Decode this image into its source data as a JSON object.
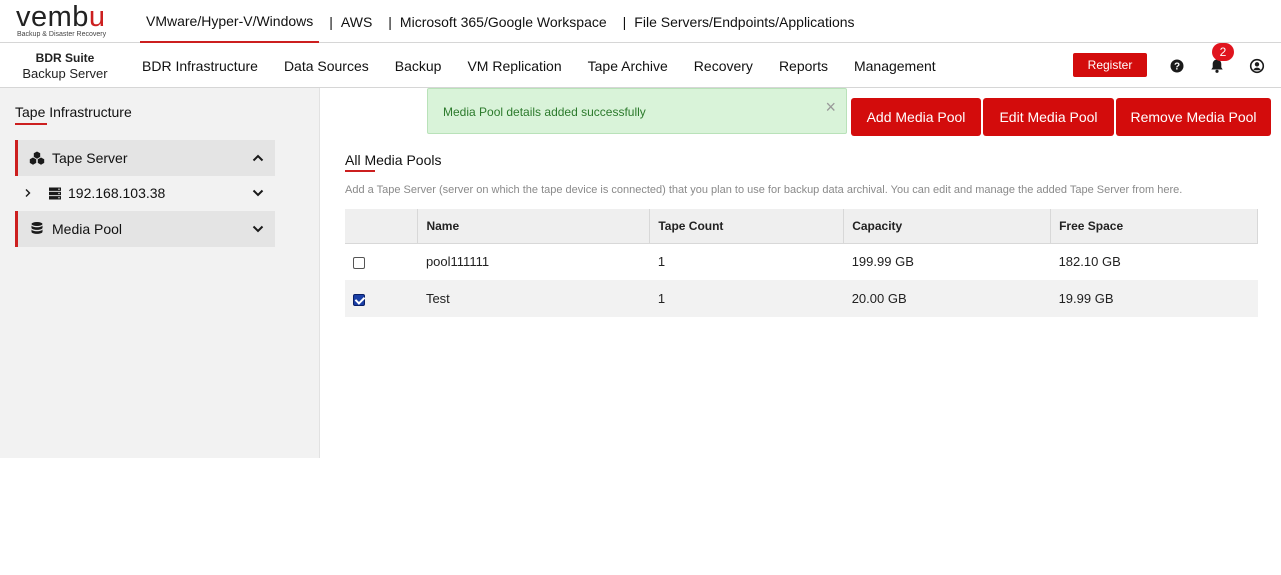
{
  "logo": {
    "word_start": "vemb",
    "word_end": "u",
    "tagline": "Backup & Disaster Recovery"
  },
  "product_tabs": [
    {
      "label": "VMware/Hyper-V/Windows",
      "active": true
    },
    {
      "label": "AWS",
      "active": false
    },
    {
      "label": "Microsoft 365/Google Workspace",
      "active": false
    },
    {
      "label": "File Servers/Endpoints/Applications",
      "active": false
    }
  ],
  "separator": "|",
  "brand": {
    "top": "BDR Suite",
    "bottom": "Backup Server"
  },
  "nav": [
    "BDR Infrastructure",
    "Data Sources",
    "Backup",
    "VM Replication",
    "Tape Archive",
    "Recovery",
    "Reports",
    "Management"
  ],
  "header": {
    "register_label": "Register",
    "notification_count": "2",
    "help_icon": "question-circle-icon",
    "bell_icon": "bell-icon",
    "user_icon": "user-circle-icon"
  },
  "sidebar": {
    "title": "Tape Infrastructure",
    "tape_server": {
      "label": "Tape Server",
      "icon": "server-cluster-icon",
      "expanded": true
    },
    "server_ip": "192.168.103.38",
    "media_pool": {
      "label": "Media Pool",
      "icon": "database-icon",
      "expanded": false
    }
  },
  "toast": {
    "message": "Media Pool details added successfully",
    "close": "×"
  },
  "actions": {
    "add": "Add Media Pool",
    "edit": "Edit Media Pool",
    "remove": "Remove Media Pool"
  },
  "section": {
    "title": "All Media Pools",
    "description": "Add a Tape Server (server on which the tape device is connected) that you plan to use for backup data archival. You can edit and manage the added Tape Server from here."
  },
  "table": {
    "columns": [
      "Name",
      "Tape Count",
      "Capacity",
      "Free Space"
    ],
    "rows": [
      {
        "checked": false,
        "name": "pool111111",
        "tape_count": "1",
        "capacity": "199.99 GB",
        "free_space": "182.10 GB"
      },
      {
        "checked": true,
        "name": "Test",
        "tape_count": "1",
        "capacity": "20.00 GB",
        "free_space": "19.99 GB"
      }
    ]
  },
  "colors": {
    "accent": "#d30c0c",
    "toast_bg": "#d9f3d9",
    "toast_text": "#2c7a2c",
    "sidebar_bg": "#f2f2f2"
  }
}
